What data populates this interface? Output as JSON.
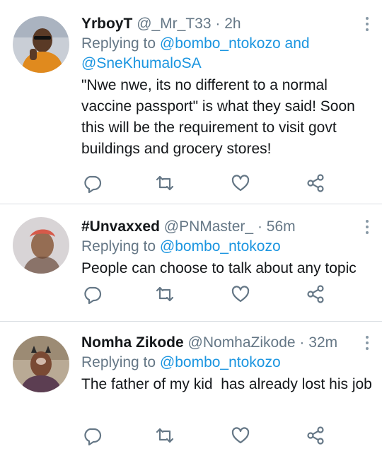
{
  "tweets": [
    {
      "name": "YrboyT",
      "handle": "@_Mr_T33",
      "dot": "·",
      "time": "2h",
      "replying_prefix": "Replying to",
      "mention1": "@bombo_ntokozo",
      "joiner": "and",
      "mention2": "@SneKhumaloSA",
      "text": "\"Nwe nwe, its no different to a normal vaccine passport\" is what they said! Soon this will be the requirement to visit govt buildings and grocery stores!"
    },
    {
      "name": "#Unvaxxed",
      "handle": "@PNMaster_",
      "dot": "·",
      "time": "56m",
      "replying_prefix": "Replying to",
      "mention1": "@bombo_ntokozo",
      "text": "People can choose to talk about any topic"
    },
    {
      "name": "Nomha Zikode",
      "handle": "@NomhaZikode",
      "dot": "·",
      "time": "32m",
      "replying_prefix": "Replying to",
      "mention1": "@bombo_ntokozo",
      "text": "The father of my kid  has already lost his job"
    }
  ],
  "icons": {
    "reply": "reply-icon",
    "retweet": "retweet-icon",
    "like": "heart-icon",
    "share": "share-icon",
    "more": "more-vertical-icon"
  },
  "colors": {
    "mention": "#1b95e0",
    "secondary": "#657786",
    "divider": "#d9dee2",
    "icon": "#657786"
  }
}
